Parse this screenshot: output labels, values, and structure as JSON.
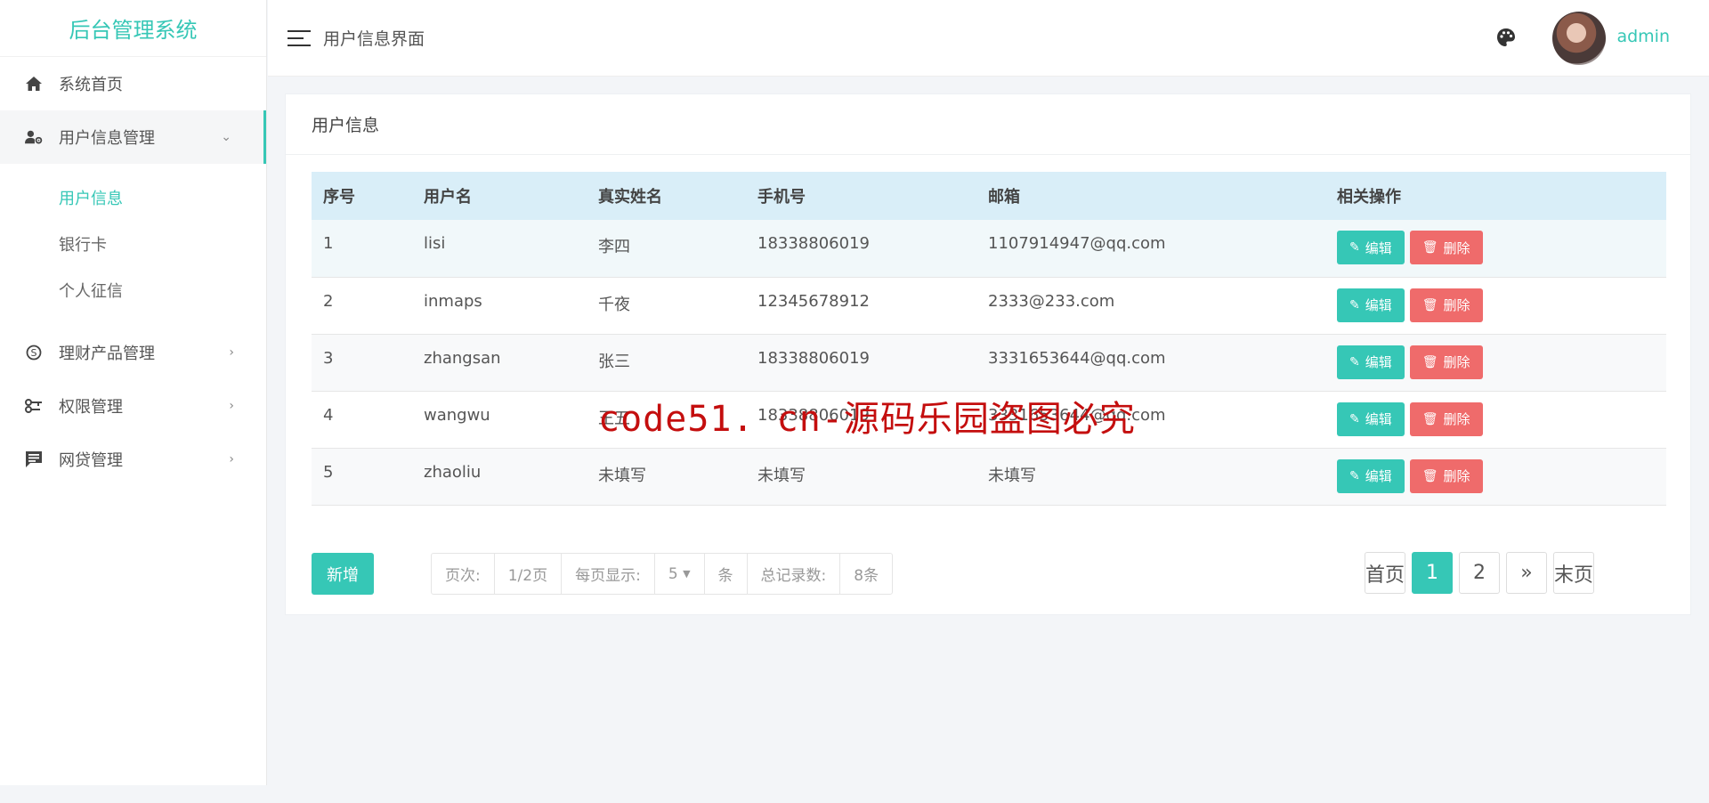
{
  "sidebar": {
    "brand": "后台管理系统",
    "items": [
      {
        "label": "系统首页",
        "icon": "home-icon"
      },
      {
        "label": "用户信息管理",
        "icon": "user-gear-icon",
        "open": true
      },
      {
        "label": "理财产品管理",
        "icon": "finance-icon"
      },
      {
        "label": "权限管理",
        "icon": "key-icon"
      },
      {
        "label": "网贷管理",
        "icon": "message-icon"
      }
    ],
    "subitems": [
      {
        "label": "用户信息",
        "active": true
      },
      {
        "label": "银行卡"
      },
      {
        "label": "个人征信"
      }
    ]
  },
  "header": {
    "title": "用户信息界面",
    "username": "admin"
  },
  "panel": {
    "title": "用户信息",
    "columns": [
      "序号",
      "用户名",
      "真实姓名",
      "手机号",
      "邮箱",
      "相关操作"
    ],
    "rows": [
      [
        "1",
        "lisi",
        "李四",
        "18338806019",
        "1107914947@qq.com"
      ],
      [
        "2",
        "inmaps",
        "千夜",
        "12345678912",
        "2333@233.com"
      ],
      [
        "3",
        "zhangsan",
        "张三",
        "18338806019",
        "3331653644@qq.com"
      ],
      [
        "4",
        "wangwu",
        "王五",
        "18338806019",
        "3331653644@qq.com"
      ],
      [
        "5",
        "zhaoliu",
        "未填写",
        "未填写",
        "未填写"
      ]
    ],
    "edit_label": "编辑",
    "delete_label": "删除",
    "add_label": "新增",
    "pageinfo": {
      "page_label": "页次:",
      "page_value": "1/2页",
      "per_page_label": "每页显示:",
      "per_page_value": "5",
      "per_page_unit": "条",
      "total_label": "总记录数:",
      "total_value": "8条"
    },
    "pager": [
      "首页",
      "1",
      "2",
      "»",
      "末页"
    ]
  },
  "watermark": "code51. cn-源码乐园盗图必究",
  "colors": {
    "accent": "#36c7b6",
    "danger": "#ef6b6b",
    "table_head": "#d9eef8"
  }
}
